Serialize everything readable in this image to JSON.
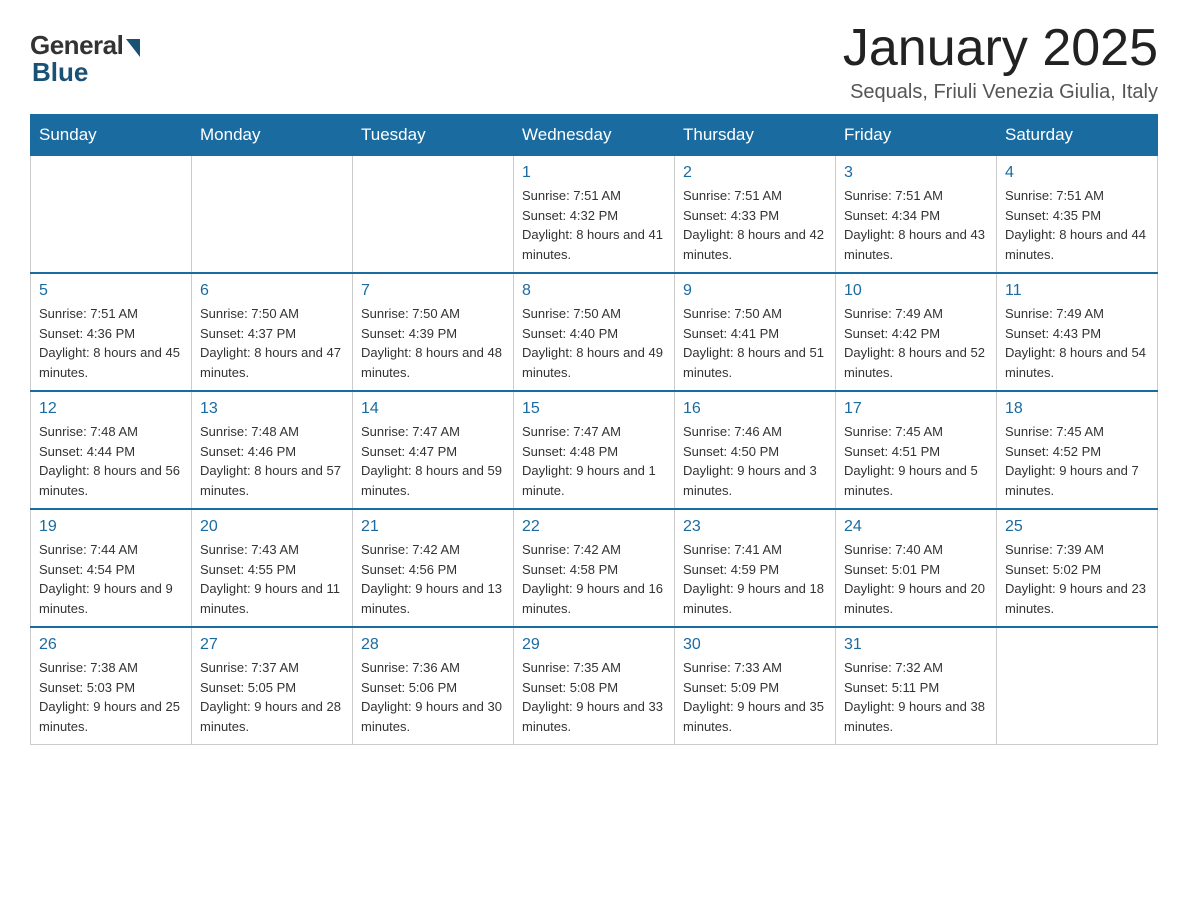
{
  "header": {
    "logo_general": "General",
    "logo_blue": "Blue",
    "month_title": "January 2025",
    "subtitle": "Sequals, Friuli Venezia Giulia, Italy"
  },
  "days_of_week": [
    "Sunday",
    "Monday",
    "Tuesday",
    "Wednesday",
    "Thursday",
    "Friday",
    "Saturday"
  ],
  "weeks": [
    [
      {
        "day": "",
        "info": ""
      },
      {
        "day": "",
        "info": ""
      },
      {
        "day": "",
        "info": ""
      },
      {
        "day": "1",
        "info": "Sunrise: 7:51 AM\nSunset: 4:32 PM\nDaylight: 8 hours and 41 minutes."
      },
      {
        "day": "2",
        "info": "Sunrise: 7:51 AM\nSunset: 4:33 PM\nDaylight: 8 hours and 42 minutes."
      },
      {
        "day": "3",
        "info": "Sunrise: 7:51 AM\nSunset: 4:34 PM\nDaylight: 8 hours and 43 minutes."
      },
      {
        "day": "4",
        "info": "Sunrise: 7:51 AM\nSunset: 4:35 PM\nDaylight: 8 hours and 44 minutes."
      }
    ],
    [
      {
        "day": "5",
        "info": "Sunrise: 7:51 AM\nSunset: 4:36 PM\nDaylight: 8 hours and 45 minutes."
      },
      {
        "day": "6",
        "info": "Sunrise: 7:50 AM\nSunset: 4:37 PM\nDaylight: 8 hours and 47 minutes."
      },
      {
        "day": "7",
        "info": "Sunrise: 7:50 AM\nSunset: 4:39 PM\nDaylight: 8 hours and 48 minutes."
      },
      {
        "day": "8",
        "info": "Sunrise: 7:50 AM\nSunset: 4:40 PM\nDaylight: 8 hours and 49 minutes."
      },
      {
        "day": "9",
        "info": "Sunrise: 7:50 AM\nSunset: 4:41 PM\nDaylight: 8 hours and 51 minutes."
      },
      {
        "day": "10",
        "info": "Sunrise: 7:49 AM\nSunset: 4:42 PM\nDaylight: 8 hours and 52 minutes."
      },
      {
        "day": "11",
        "info": "Sunrise: 7:49 AM\nSunset: 4:43 PM\nDaylight: 8 hours and 54 minutes."
      }
    ],
    [
      {
        "day": "12",
        "info": "Sunrise: 7:48 AM\nSunset: 4:44 PM\nDaylight: 8 hours and 56 minutes."
      },
      {
        "day": "13",
        "info": "Sunrise: 7:48 AM\nSunset: 4:46 PM\nDaylight: 8 hours and 57 minutes."
      },
      {
        "day": "14",
        "info": "Sunrise: 7:47 AM\nSunset: 4:47 PM\nDaylight: 8 hours and 59 minutes."
      },
      {
        "day": "15",
        "info": "Sunrise: 7:47 AM\nSunset: 4:48 PM\nDaylight: 9 hours and 1 minute."
      },
      {
        "day": "16",
        "info": "Sunrise: 7:46 AM\nSunset: 4:50 PM\nDaylight: 9 hours and 3 minutes."
      },
      {
        "day": "17",
        "info": "Sunrise: 7:45 AM\nSunset: 4:51 PM\nDaylight: 9 hours and 5 minutes."
      },
      {
        "day": "18",
        "info": "Sunrise: 7:45 AM\nSunset: 4:52 PM\nDaylight: 9 hours and 7 minutes."
      }
    ],
    [
      {
        "day": "19",
        "info": "Sunrise: 7:44 AM\nSunset: 4:54 PM\nDaylight: 9 hours and 9 minutes."
      },
      {
        "day": "20",
        "info": "Sunrise: 7:43 AM\nSunset: 4:55 PM\nDaylight: 9 hours and 11 minutes."
      },
      {
        "day": "21",
        "info": "Sunrise: 7:42 AM\nSunset: 4:56 PM\nDaylight: 9 hours and 13 minutes."
      },
      {
        "day": "22",
        "info": "Sunrise: 7:42 AM\nSunset: 4:58 PM\nDaylight: 9 hours and 16 minutes."
      },
      {
        "day": "23",
        "info": "Sunrise: 7:41 AM\nSunset: 4:59 PM\nDaylight: 9 hours and 18 minutes."
      },
      {
        "day": "24",
        "info": "Sunrise: 7:40 AM\nSunset: 5:01 PM\nDaylight: 9 hours and 20 minutes."
      },
      {
        "day": "25",
        "info": "Sunrise: 7:39 AM\nSunset: 5:02 PM\nDaylight: 9 hours and 23 minutes."
      }
    ],
    [
      {
        "day": "26",
        "info": "Sunrise: 7:38 AM\nSunset: 5:03 PM\nDaylight: 9 hours and 25 minutes."
      },
      {
        "day": "27",
        "info": "Sunrise: 7:37 AM\nSunset: 5:05 PM\nDaylight: 9 hours and 28 minutes."
      },
      {
        "day": "28",
        "info": "Sunrise: 7:36 AM\nSunset: 5:06 PM\nDaylight: 9 hours and 30 minutes."
      },
      {
        "day": "29",
        "info": "Sunrise: 7:35 AM\nSunset: 5:08 PM\nDaylight: 9 hours and 33 minutes."
      },
      {
        "day": "30",
        "info": "Sunrise: 7:33 AM\nSunset: 5:09 PM\nDaylight: 9 hours and 35 minutes."
      },
      {
        "day": "31",
        "info": "Sunrise: 7:32 AM\nSunset: 5:11 PM\nDaylight: 9 hours and 38 minutes."
      },
      {
        "day": "",
        "info": ""
      }
    ]
  ]
}
